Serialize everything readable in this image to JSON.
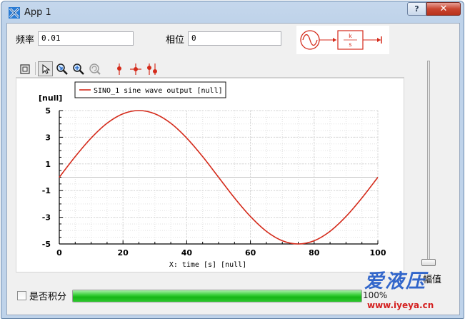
{
  "window": {
    "title": "App 1",
    "help_label": "?",
    "close_label": "✕"
  },
  "controls": {
    "frequency_label": "频率",
    "frequency_value": "0.01",
    "phase_label": "相位",
    "phase_value": "0",
    "slider_label": "幅值",
    "integrate_label": "是否积分",
    "progress_fraction": 1.0,
    "progress_text": "100%"
  },
  "block_diagram": {
    "gain_label": "k",
    "integrator_label": "s"
  },
  "toolbar": {
    "icons": [
      "layout-icon",
      "pointer-icon",
      "zoom-in-icon",
      "zoom-fit-icon",
      "zoom-reset-icon",
      "cursor-icon",
      "cursor-add-icon",
      "cursor-delta-icon"
    ]
  },
  "chart_data": {
    "type": "line",
    "ylabel": "[null]",
    "xlabel": "X: time [s] [null]",
    "xlim": [
      0,
      100
    ],
    "ylim": [
      -5,
      5
    ],
    "xticks": [
      "0",
      "20",
      "40",
      "60",
      "80",
      "100"
    ],
    "yticks": [
      "5",
      "3",
      "1",
      "-1",
      "-3",
      "-5"
    ],
    "grid": true,
    "legend_position": "top",
    "series": [
      {
        "name": "SINO_1 sine wave output [null]",
        "color": "#d42a1a",
        "x": [
          0,
          5,
          10,
          15,
          20,
          25,
          30,
          35,
          40,
          45,
          50,
          55,
          60,
          65,
          70,
          75,
          80,
          85,
          90,
          95,
          100
        ],
        "y": [
          0,
          1.55,
          2.94,
          4.05,
          4.76,
          5.0,
          4.76,
          4.05,
          2.94,
          1.55,
          0,
          -1.55,
          -2.94,
          -4.05,
          -4.76,
          -5.0,
          -4.76,
          -4.05,
          -2.94,
          -1.55,
          0
        ]
      }
    ]
  },
  "watermark": {
    "text": "爱液压",
    "url": "www.iyeya.cn"
  },
  "colors": {
    "accent": "#1e58c8",
    "progress": "#22c022",
    "curve": "#d42a1a"
  }
}
